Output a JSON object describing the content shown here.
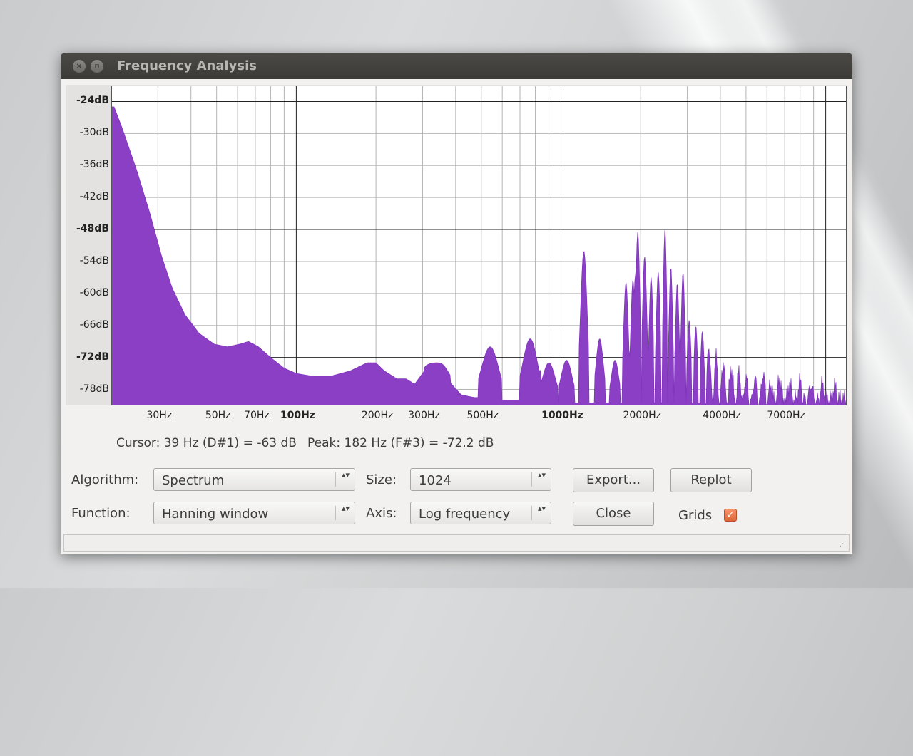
{
  "window": {
    "title": "Frequency Analysis",
    "close_glyph": "×",
    "minimize_glyph": "▫"
  },
  "status": {
    "cursor": "Cursor: 39 Hz (D#1) = -63 dB",
    "peak": "Peak: 182 Hz (F#3) = -72.2 dB"
  },
  "controls": {
    "algorithm_label": "Algorithm:",
    "algorithm_value": "Spectrum",
    "function_label": "Function:",
    "function_value": "Hanning window",
    "size_label": "Size:",
    "size_value": "1024",
    "axis_label": "Axis:",
    "axis_value": "Log frequency",
    "export_label": "Export...",
    "replot_label": "Replot",
    "close_label": "Close",
    "grids_label": "Grids",
    "grids_checked": true,
    "grids_glyph": "✓",
    "combo_arrows": "▴▾"
  },
  "colors": {
    "fill": "#8a3fc4",
    "titlebar": "#3c3b37",
    "checkbox": "#e9774a"
  },
  "chart_data": {
    "type": "area",
    "xscale": "log",
    "xlim": [
      20,
      12000
    ],
    "ylim": [
      -81,
      -21
    ],
    "grid": true,
    "y_ticks": [
      {
        "label": "-24dB",
        "value": -24,
        "bold": true
      },
      {
        "label": "-30dB",
        "value": -30,
        "bold": false
      },
      {
        "label": "-36dB",
        "value": -36,
        "bold": false
      },
      {
        "label": "-42dB",
        "value": -42,
        "bold": false
      },
      {
        "label": "-48dB",
        "value": -48,
        "bold": true
      },
      {
        "label": "-54dB",
        "value": -54,
        "bold": false
      },
      {
        "label": "-60dB",
        "value": -60,
        "bold": false
      },
      {
        "label": "-66dB",
        "value": -66,
        "bold": false
      },
      {
        "label": "-72dB",
        "value": -72,
        "bold": true
      },
      {
        "label": "-78dB",
        "value": -78,
        "bold": false
      }
    ],
    "x_ticks": [
      {
        "label": "30Hz",
        "value": 30,
        "bold": false
      },
      {
        "label": "50Hz",
        "value": 50,
        "bold": false
      },
      {
        "label": "70Hz",
        "value": 70,
        "bold": false
      },
      {
        "label": "100Hz",
        "value": 100,
        "bold": true
      },
      {
        "label": "200Hz",
        "value": 200,
        "bold": false
      },
      {
        "label": "300Hz",
        "value": 300,
        "bold": false
      },
      {
        "label": "500Hz",
        "value": 500,
        "bold": false
      },
      {
        "label": "1000Hz",
        "value": 1000,
        "bold": true
      },
      {
        "label": "2000Hz",
        "value": 2000,
        "bold": false
      },
      {
        "label": "4000Hz",
        "value": 4000,
        "bold": false
      },
      {
        "label": "7000Hz",
        "value": 7000,
        "bold": false
      }
    ],
    "baseline_db": -78,
    "envelope": [
      [
        20.5,
        -25
      ],
      [
        22,
        -29
      ],
      [
        25,
        -37
      ],
      [
        28,
        -45
      ],
      [
        31,
        -53
      ],
      [
        34,
        -59
      ],
      [
        38,
        -64
      ],
      [
        43,
        -67.5
      ],
      [
        49,
        -69.5
      ],
      [
        55,
        -70
      ],
      [
        61,
        -69.5
      ],
      [
        66,
        -69
      ],
      [
        72,
        -70
      ],
      [
        80,
        -72
      ],
      [
        90,
        -74
      ],
      [
        100,
        -75
      ],
      [
        115,
        -75.5
      ],
      [
        135,
        -75.5
      ],
      [
        160,
        -74.5
      ],
      [
        185,
        -73
      ],
      [
        200,
        -73
      ],
      [
        215,
        -74.5
      ],
      [
        240,
        -76
      ],
      [
        260,
        -76
      ],
      [
        280,
        -77
      ],
      [
        310,
        -74
      ],
      [
        340,
        -73
      ],
      [
        370,
        -76
      ],
      [
        420,
        -79
      ],
      [
        470,
        -79.5
      ],
      [
        520,
        -79.5
      ],
      [
        600,
        -80
      ],
      [
        700,
        -80
      ],
      [
        900,
        -80.5
      ],
      [
        1200,
        -80.5
      ],
      [
        2000,
        -80.5
      ],
      [
        4000,
        -80.5
      ],
      [
        8000,
        -80
      ],
      [
        11500,
        -80
      ]
    ],
    "peaks": [
      [
        340,
        -73,
        0.05
      ],
      [
        540,
        -70,
        0.045
      ],
      [
        765,
        -68.5,
        0.04
      ],
      [
        900,
        -73,
        0.035
      ],
      [
        1050,
        -72.5,
        0.03
      ],
      [
        1220,
        -52,
        0.018
      ],
      [
        1400,
        -68.5,
        0.02
      ],
      [
        1600,
        -72.5,
        0.02
      ],
      [
        1760,
        -58,
        0.013
      ],
      [
        1870,
        -57.5,
        0.012
      ],
      [
        1950,
        -48.5,
        0.012
      ],
      [
        2070,
        -53,
        0.012
      ],
      [
        2190,
        -57,
        0.011
      ],
      [
        2330,
        -56,
        0.011
      ],
      [
        2470,
        -48,
        0.01
      ],
      [
        2600,
        -55,
        0.01
      ],
      [
        2750,
        -58,
        0.01
      ],
      [
        2890,
        -56,
        0.01
      ],
      [
        3050,
        -65,
        0.01
      ],
      [
        3230,
        -66,
        0.009
      ],
      [
        3420,
        -67,
        0.009
      ],
      [
        3620,
        -70,
        0.009
      ],
      [
        3850,
        -72,
        0.009
      ],
      [
        4100,
        -73,
        0.009
      ],
      [
        4400,
        -74,
        0.009
      ],
      [
        4700,
        -75,
        0.009
      ],
      [
        5000,
        -76,
        0.009
      ],
      [
        5400,
        -76,
        0.009
      ],
      [
        5800,
        -75,
        0.009
      ],
      [
        6200,
        -77,
        0.009
      ],
      [
        6700,
        -76,
        0.009
      ],
      [
        7300,
        -77,
        0.009
      ],
      [
        8000,
        -76.5,
        0.009
      ],
      [
        8800,
        -77,
        0.009
      ],
      [
        9700,
        -77,
        0.009
      ],
      [
        10800,
        -77.5,
        0.009
      ]
    ]
  }
}
